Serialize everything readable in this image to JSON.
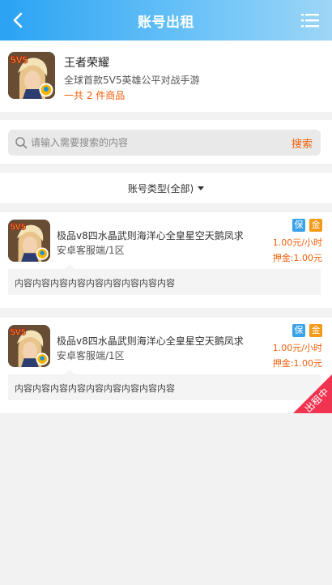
{
  "header": {
    "title": "账号出租",
    "back_icon": "back-arrow-icon",
    "menu_icon": "list-menu-icon"
  },
  "game": {
    "logo_text": "5V5",
    "name": "王者荣耀",
    "description": "全球首款5V5英雄公平对战手游",
    "count_text": "一共 2 件商品"
  },
  "search": {
    "placeholder": "请输入需要搜索的内容",
    "value": "",
    "button_label": "搜索"
  },
  "filter": {
    "label": "账号类型(全部)"
  },
  "items": [
    {
      "title": "极品v8四水晶武则海洋心全皇星空天鹅凤求",
      "server": "安卓客服端/1区",
      "badge_bao": "保",
      "badge_jin": "金",
      "price": "1.00元/小时",
      "deposit": "押金:1.00元",
      "content": "内容内容内容内容内容内容内容内容内容",
      "tag": ""
    },
    {
      "title": "极品v8四水晶武则海洋心全皇星空天鹅凤求",
      "server": "安卓客服端/1区",
      "badge_bao": "保",
      "badge_jin": "金",
      "price": "1.00元/小时",
      "deposit": "押金:1.00元",
      "content": "内容内容内容内容内容内容内容内容内容",
      "tag": "出租中"
    }
  ],
  "colors": {
    "header_start": "#2aa3f3",
    "header_end": "#9dd6f7",
    "accent_orange": "#f0600a",
    "badge_blue": "#3aa2ea",
    "badge_orange": "#f39a16",
    "rent_tag_red": "#f0344f"
  }
}
